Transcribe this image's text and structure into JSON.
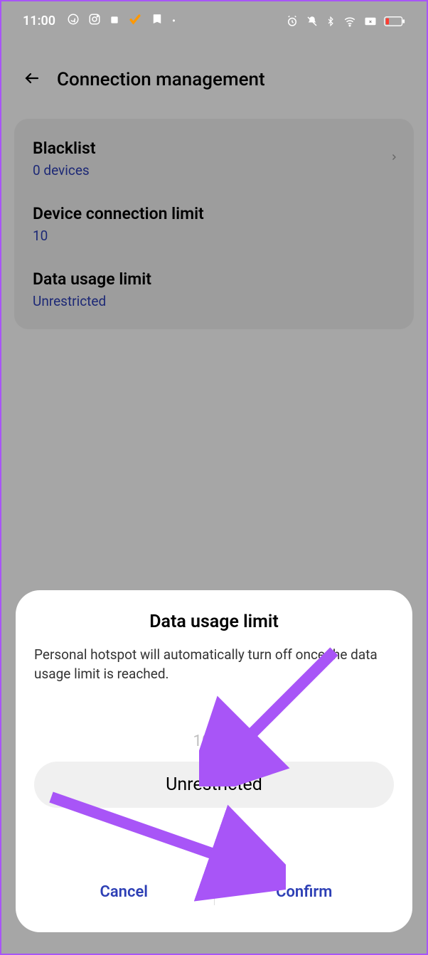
{
  "status": {
    "time": "11:00"
  },
  "header": {
    "title": "Connection management"
  },
  "settings": {
    "blacklist": {
      "title": "Blacklist",
      "value": "0 devices"
    },
    "connectionLimit": {
      "title": "Device connection limit",
      "value": "10"
    },
    "dataUsageLimit": {
      "title": "Data usage limit",
      "value": "Unrestricted"
    }
  },
  "modal": {
    "title": "Data usage limit",
    "description": "Personal hotspot will automatically turn off once the data usage limit is reached.",
    "optionAbove": "10 GB",
    "optionSelected": "Unrestricted",
    "cancelLabel": "Cancel",
    "confirmLabel": "Confirm"
  }
}
